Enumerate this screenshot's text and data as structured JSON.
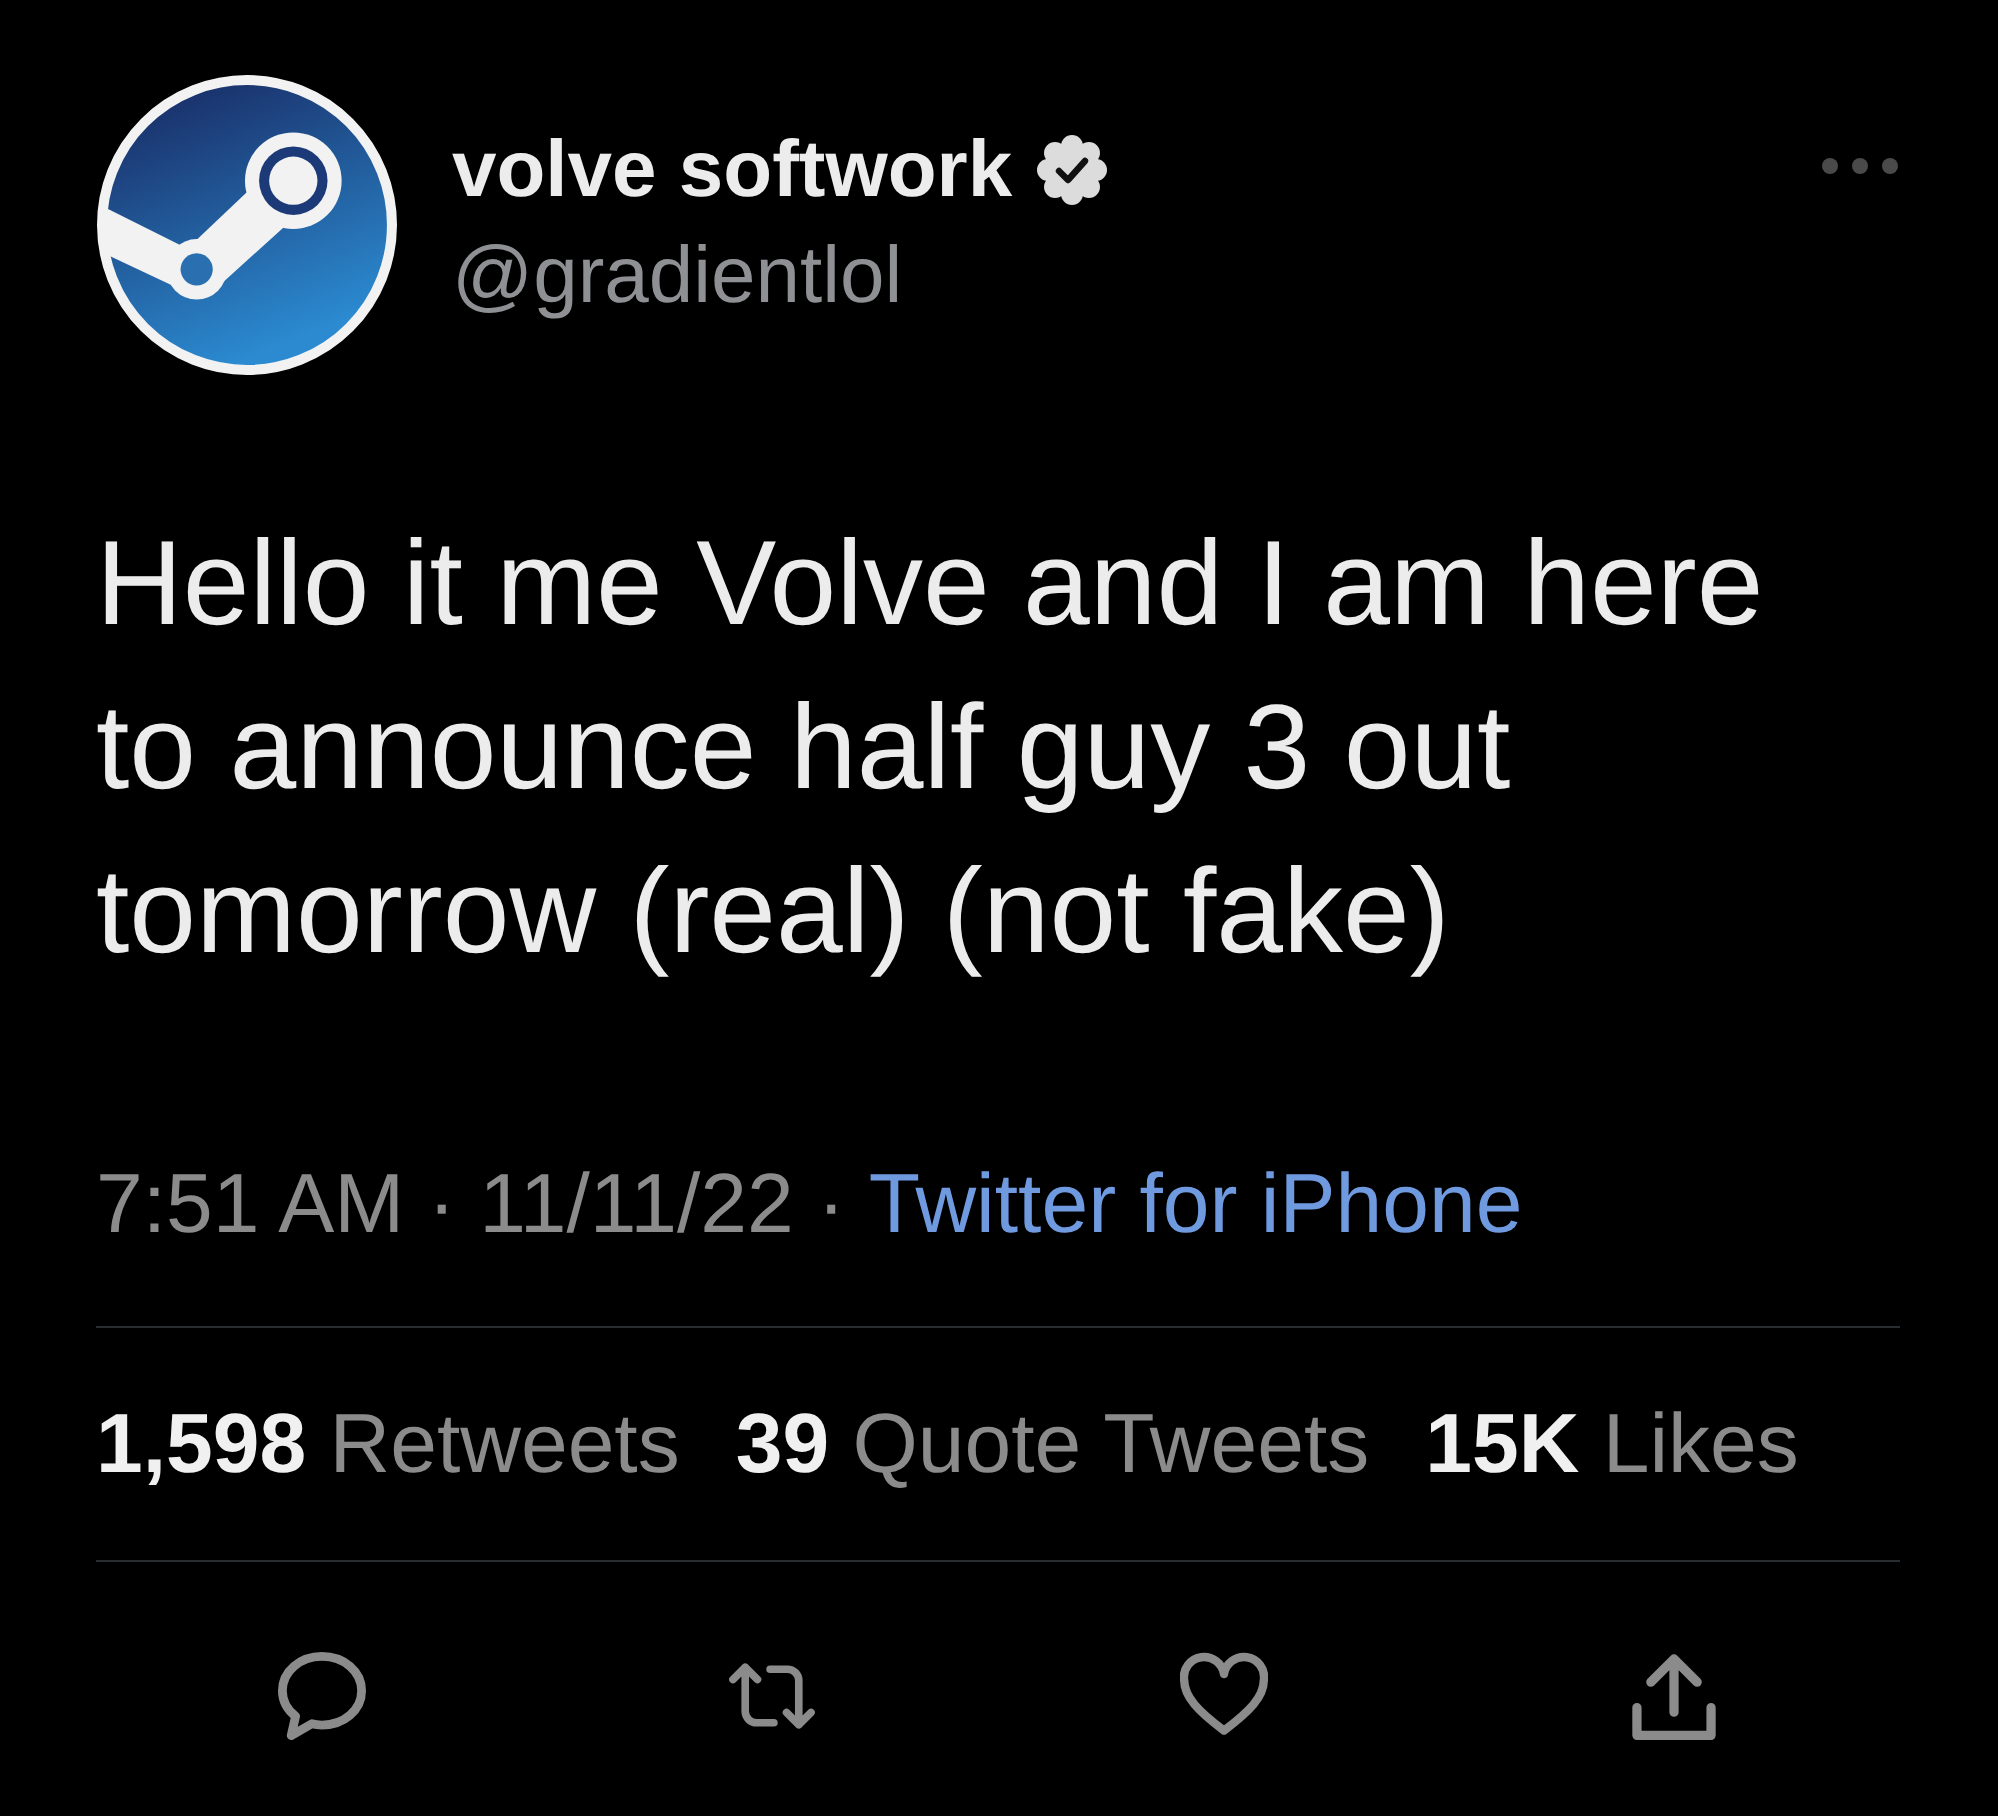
{
  "author": {
    "name": "volve softwork",
    "verified": true,
    "handle": "@gradientlol"
  },
  "tweet": {
    "text": "Hello it me Volve and I am here to announce half guy 3 out tomorrow (real) (not fake)"
  },
  "meta": [
    {
      "kind": "text",
      "text": "7:51 AM"
    },
    {
      "kind": "separator",
      "text": "·"
    },
    {
      "kind": "text",
      "text": "11/11/22"
    },
    {
      "kind": "separator",
      "text": "·"
    },
    {
      "kind": "link",
      "text": "Twitter for iPhone"
    }
  ],
  "stats": [
    {
      "count": "1,598",
      "label": "Retweets"
    },
    {
      "count": "39",
      "label": "Quote Tweets"
    },
    {
      "count": "15K",
      "label": "Likes"
    }
  ]
}
